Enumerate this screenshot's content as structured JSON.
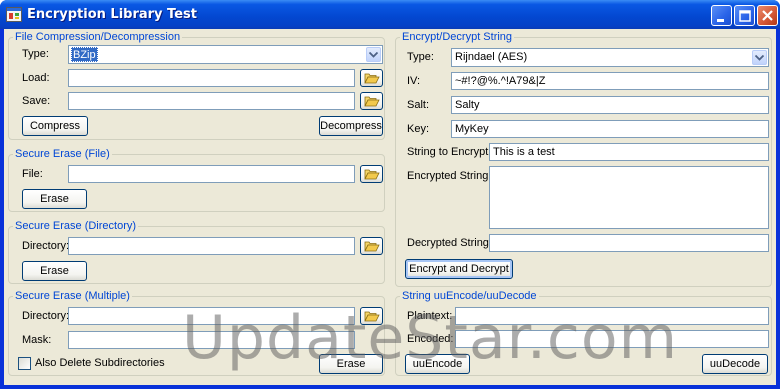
{
  "window": {
    "title": "Encryption Library Test"
  },
  "file_compression": {
    "group_label": "File Compression/Decompression",
    "type_label": "Type:",
    "type_value": "BZip",
    "load_label": "Load:",
    "load_value": "",
    "save_label": "Save:",
    "save_value": "",
    "compress_button": "Compress",
    "decompress_button": "Decompress"
  },
  "secure_erase_file": {
    "group_label": "Secure Erase (File)",
    "file_label": "File:",
    "file_value": "",
    "erase_button": "Erase"
  },
  "secure_erase_directory": {
    "group_label": "Secure Erase (Directory)",
    "directory_label": "Directory:",
    "directory_value": "",
    "erase_button": "Erase"
  },
  "secure_erase_multiple": {
    "group_label": "Secure Erase (Multiple)",
    "directory_label": "Directory:",
    "directory_value": "",
    "mask_label": "Mask:",
    "mask_value": "",
    "subdir_checkbox_label": "Also Delete Subdirectories",
    "subdir_checked": false,
    "erase_button": "Erase"
  },
  "encrypt_decrypt": {
    "group_label": "Encrypt/Decrypt String",
    "type_label": "Type:",
    "type_value": "Rijndael (AES)",
    "iv_label": "IV:",
    "iv_value": "~#!?@%.^!A79&|Z",
    "salt_label": "Salt:",
    "salt_value": "Salty",
    "key_label": "Key:",
    "key_value": "MyKey",
    "string_to_encrypt_label": "String to Encrypt:",
    "string_to_encrypt_value": "This is a test",
    "encrypted_string_label": "Encrypted String:",
    "encrypted_string_value": "",
    "decrypted_string_label": "Decrypted String:",
    "decrypted_string_value": "",
    "encrypt_decrypt_button": "Encrypt and Decrypt"
  },
  "uuencode": {
    "group_label": "String uuEncode/uuDecode",
    "plaintext_label": "Plaintext:",
    "plaintext_value": "",
    "encoded_label": "Encoded:",
    "encoded_value": "",
    "uuencode_button": "uuEncode",
    "uudecode_button": "uuDecode"
  },
  "watermark": "UpdateStar.com",
  "icons": [
    "app-icon",
    "minimize-icon",
    "maximize-icon",
    "close-icon",
    "folder-open-icon",
    "chevron-down-icon"
  ],
  "colors": {
    "titlebar": "#0a58e4",
    "client": "#ece9d8",
    "group_label": "#0046d5",
    "selection": "#316ac5"
  }
}
